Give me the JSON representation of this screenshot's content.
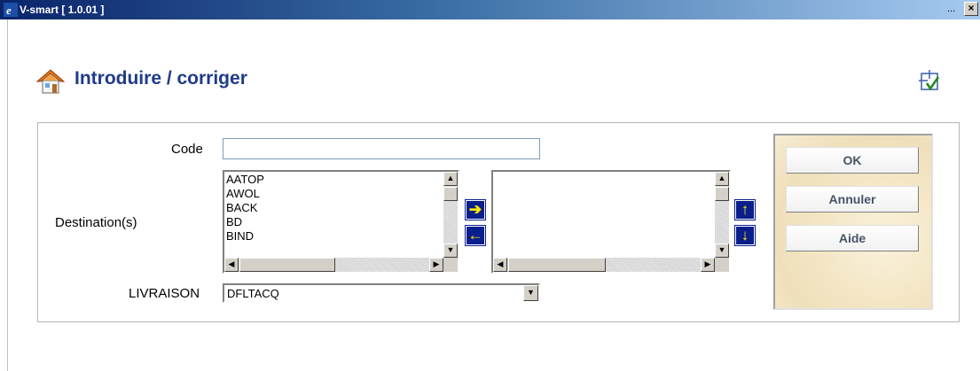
{
  "window": {
    "title": "V-smart [ 1.0.01 ]",
    "dots": "...",
    "close_glyph": "×"
  },
  "page": {
    "title": "Introduire / corriger",
    "icons": [
      "home-icon",
      "layout-icon"
    ]
  },
  "form": {
    "code_label": "Code",
    "code_value": "",
    "destination_label": "Destination(s)",
    "available_destinations": [
      "AATOP",
      "AWOL",
      "BACK",
      "BD",
      "BIND"
    ],
    "selected_destinations": [],
    "livraison_label": "LIVRAISON",
    "livraison_value": "DFLTACQ"
  },
  "arrows": {
    "add": "➔",
    "remove": "🡐",
    "up": "🡑",
    "down": "🡓"
  },
  "buttons": {
    "ok": "OK",
    "cancel": "Annuler",
    "help": "Aide"
  },
  "colors": {
    "title_blue": "#1f3b8a",
    "arrow_bg": "#0a1f8c",
    "arrow_fg": "#ffee00"
  }
}
